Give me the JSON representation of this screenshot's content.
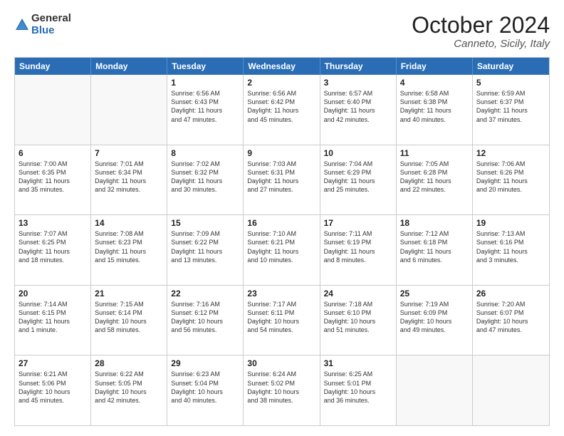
{
  "header": {
    "logo_general": "General",
    "logo_blue": "Blue",
    "month_title": "October 2024",
    "location": "Canneto, Sicily, Italy"
  },
  "calendar": {
    "days_of_week": [
      "Sunday",
      "Monday",
      "Tuesday",
      "Wednesday",
      "Thursday",
      "Friday",
      "Saturday"
    ],
    "rows": [
      [
        {
          "day": "",
          "empty": true
        },
        {
          "day": "",
          "empty": true
        },
        {
          "day": "1",
          "lines": [
            "Sunrise: 6:56 AM",
            "Sunset: 6:43 PM",
            "Daylight: 11 hours",
            "and 47 minutes."
          ]
        },
        {
          "day": "2",
          "lines": [
            "Sunrise: 6:56 AM",
            "Sunset: 6:42 PM",
            "Daylight: 11 hours",
            "and 45 minutes."
          ]
        },
        {
          "day": "3",
          "lines": [
            "Sunrise: 6:57 AM",
            "Sunset: 6:40 PM",
            "Daylight: 11 hours",
            "and 42 minutes."
          ]
        },
        {
          "day": "4",
          "lines": [
            "Sunrise: 6:58 AM",
            "Sunset: 6:38 PM",
            "Daylight: 11 hours",
            "and 40 minutes."
          ]
        },
        {
          "day": "5",
          "lines": [
            "Sunrise: 6:59 AM",
            "Sunset: 6:37 PM",
            "Daylight: 11 hours",
            "and 37 minutes."
          ]
        }
      ],
      [
        {
          "day": "6",
          "lines": [
            "Sunrise: 7:00 AM",
            "Sunset: 6:35 PM",
            "Daylight: 11 hours",
            "and 35 minutes."
          ]
        },
        {
          "day": "7",
          "lines": [
            "Sunrise: 7:01 AM",
            "Sunset: 6:34 PM",
            "Daylight: 11 hours",
            "and 32 minutes."
          ]
        },
        {
          "day": "8",
          "lines": [
            "Sunrise: 7:02 AM",
            "Sunset: 6:32 PM",
            "Daylight: 11 hours",
            "and 30 minutes."
          ]
        },
        {
          "day": "9",
          "lines": [
            "Sunrise: 7:03 AM",
            "Sunset: 6:31 PM",
            "Daylight: 11 hours",
            "and 27 minutes."
          ]
        },
        {
          "day": "10",
          "lines": [
            "Sunrise: 7:04 AM",
            "Sunset: 6:29 PM",
            "Daylight: 11 hours",
            "and 25 minutes."
          ]
        },
        {
          "day": "11",
          "lines": [
            "Sunrise: 7:05 AM",
            "Sunset: 6:28 PM",
            "Daylight: 11 hours",
            "and 22 minutes."
          ]
        },
        {
          "day": "12",
          "lines": [
            "Sunrise: 7:06 AM",
            "Sunset: 6:26 PM",
            "Daylight: 11 hours",
            "and 20 minutes."
          ]
        }
      ],
      [
        {
          "day": "13",
          "lines": [
            "Sunrise: 7:07 AM",
            "Sunset: 6:25 PM",
            "Daylight: 11 hours",
            "and 18 minutes."
          ]
        },
        {
          "day": "14",
          "lines": [
            "Sunrise: 7:08 AM",
            "Sunset: 6:23 PM",
            "Daylight: 11 hours",
            "and 15 minutes."
          ]
        },
        {
          "day": "15",
          "lines": [
            "Sunrise: 7:09 AM",
            "Sunset: 6:22 PM",
            "Daylight: 11 hours",
            "and 13 minutes."
          ]
        },
        {
          "day": "16",
          "lines": [
            "Sunrise: 7:10 AM",
            "Sunset: 6:21 PM",
            "Daylight: 11 hours",
            "and 10 minutes."
          ]
        },
        {
          "day": "17",
          "lines": [
            "Sunrise: 7:11 AM",
            "Sunset: 6:19 PM",
            "Daylight: 11 hours",
            "and 8 minutes."
          ]
        },
        {
          "day": "18",
          "lines": [
            "Sunrise: 7:12 AM",
            "Sunset: 6:18 PM",
            "Daylight: 11 hours",
            "and 6 minutes."
          ]
        },
        {
          "day": "19",
          "lines": [
            "Sunrise: 7:13 AM",
            "Sunset: 6:16 PM",
            "Daylight: 11 hours",
            "and 3 minutes."
          ]
        }
      ],
      [
        {
          "day": "20",
          "lines": [
            "Sunrise: 7:14 AM",
            "Sunset: 6:15 PM",
            "Daylight: 11 hours",
            "and 1 minute."
          ]
        },
        {
          "day": "21",
          "lines": [
            "Sunrise: 7:15 AM",
            "Sunset: 6:14 PM",
            "Daylight: 10 hours",
            "and 58 minutes."
          ]
        },
        {
          "day": "22",
          "lines": [
            "Sunrise: 7:16 AM",
            "Sunset: 6:12 PM",
            "Daylight: 10 hours",
            "and 56 minutes."
          ]
        },
        {
          "day": "23",
          "lines": [
            "Sunrise: 7:17 AM",
            "Sunset: 6:11 PM",
            "Daylight: 10 hours",
            "and 54 minutes."
          ]
        },
        {
          "day": "24",
          "lines": [
            "Sunrise: 7:18 AM",
            "Sunset: 6:10 PM",
            "Daylight: 10 hours",
            "and 51 minutes."
          ]
        },
        {
          "day": "25",
          "lines": [
            "Sunrise: 7:19 AM",
            "Sunset: 6:09 PM",
            "Daylight: 10 hours",
            "and 49 minutes."
          ]
        },
        {
          "day": "26",
          "lines": [
            "Sunrise: 7:20 AM",
            "Sunset: 6:07 PM",
            "Daylight: 10 hours",
            "and 47 minutes."
          ]
        }
      ],
      [
        {
          "day": "27",
          "lines": [
            "Sunrise: 6:21 AM",
            "Sunset: 5:06 PM",
            "Daylight: 10 hours",
            "and 45 minutes."
          ]
        },
        {
          "day": "28",
          "lines": [
            "Sunrise: 6:22 AM",
            "Sunset: 5:05 PM",
            "Daylight: 10 hours",
            "and 42 minutes."
          ]
        },
        {
          "day": "29",
          "lines": [
            "Sunrise: 6:23 AM",
            "Sunset: 5:04 PM",
            "Daylight: 10 hours",
            "and 40 minutes."
          ]
        },
        {
          "day": "30",
          "lines": [
            "Sunrise: 6:24 AM",
            "Sunset: 5:02 PM",
            "Daylight: 10 hours",
            "and 38 minutes."
          ]
        },
        {
          "day": "31",
          "lines": [
            "Sunrise: 6:25 AM",
            "Sunset: 5:01 PM",
            "Daylight: 10 hours",
            "and 36 minutes."
          ]
        },
        {
          "day": "",
          "empty": true
        },
        {
          "day": "",
          "empty": true
        }
      ]
    ]
  }
}
